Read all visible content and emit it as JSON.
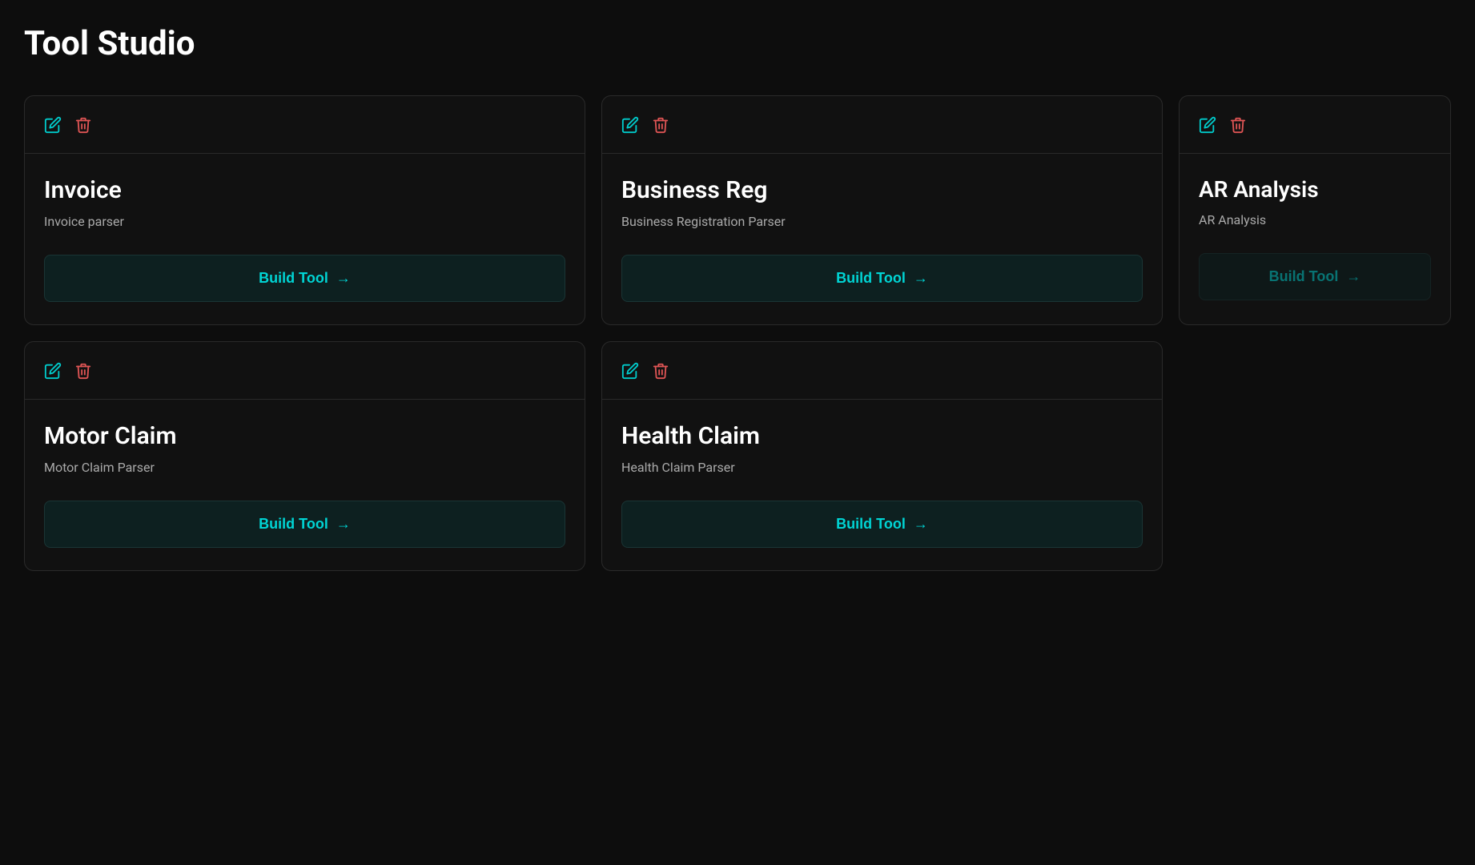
{
  "page": {
    "title": "Tool Studio"
  },
  "cards": [
    {
      "id": "invoice",
      "name": "Invoice",
      "description": "Invoice parser",
      "build_label": "Build Tool",
      "edit_icon": "✏",
      "delete_icon": "🗑"
    },
    {
      "id": "business-reg",
      "name": "Business Reg",
      "description": "Business Registration Parser",
      "build_label": "Build Tool",
      "edit_icon": "✏",
      "delete_icon": "🗑"
    },
    {
      "id": "ar-analysis",
      "name": "AR Analysis",
      "description": "AR Analysis",
      "build_label": "Build Tool",
      "edit_icon": "✏",
      "delete_icon": "🗑"
    },
    {
      "id": "motor-claim",
      "name": "Motor Claim",
      "description": "Motor Claim Parser",
      "build_label": "Build Tool",
      "edit_icon": "✏",
      "delete_icon": "🗑"
    },
    {
      "id": "health-claim",
      "name": "Health Claim",
      "description": "Health Claim Parser",
      "build_label": "Build Tool",
      "edit_icon": "✏",
      "delete_icon": "🗑"
    }
  ],
  "icons": {
    "edit": "edit-icon",
    "delete": "delete-icon",
    "arrow": "→"
  }
}
